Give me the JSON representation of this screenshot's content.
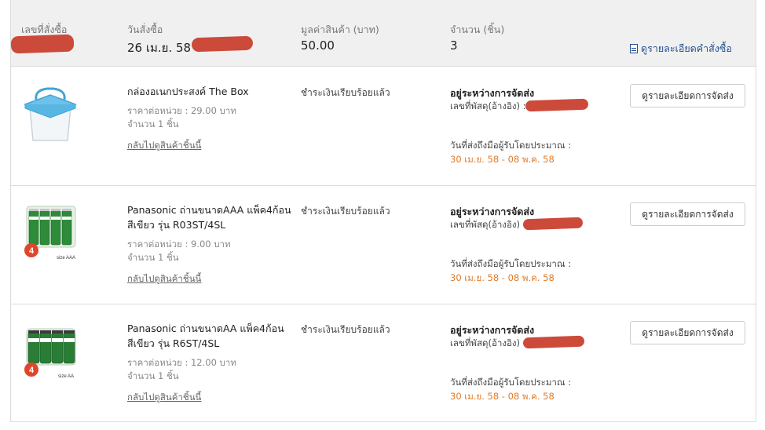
{
  "header": {
    "order_no_label": "เลขที่สั่งซื้อ",
    "order_date_label": "วันสั่งซื้อ",
    "order_date": "26 เม.ย. 58",
    "total_label": "มูลค่าสินค้า (บาท)",
    "total": "50.00",
    "qty_label": "จำนวน (ชิ้น)",
    "qty": "3",
    "detail_link": "ดูรายละเอียดคำสั่งซื้อ"
  },
  "items": [
    {
      "name": "กล่องอเนกประสงค์ The Box",
      "unit_price": "ราคาต่อหน่วย : 29.00 บาท",
      "quantity": "จำนวน 1 ชิ้น",
      "back_link": "กลับไปดูสินค้าชิ้นนี้",
      "payment": "ชำระเงินเรียบร้อยแล้ว",
      "status": "อยู่ระหว่างการจัดส่ง",
      "tracking_label": "เลขที่พัสดุ(อ้างอิง) :",
      "est_label": "วันที่ส่งถึงมือผู้รับโดยประมาณ :",
      "est_date": "30 เม.ย. 58 - 08 พ.ค. 58",
      "button": "ดูรายละเอียดการจัดส่ง"
    },
    {
      "name": "Panasonic ถ่านขนาดAAA แพ็ค4ก้อน สีเขียว รุ่น R03ST/4SL",
      "unit_price": "ราคาต่อหน่วย : 9.00 บาท",
      "quantity": "จำนวน 1 ชิ้น",
      "back_link": "กลับไปดูสินค้าชิ้นนี้",
      "payment": "ชำระเงินเรียบร้อยแล้ว",
      "status": "อยู่ระหว่างการจัดส่ง",
      "tracking_label": "เลขที่พัสดุ(อ้างอิง) :",
      "est_label": "วันที่ส่งถึงมือผู้รับโดยประมาณ :",
      "est_date": "30 เม.ย. 58 - 08 พ.ค. 58",
      "button": "ดูรายละเอียดการจัดส่ง"
    },
    {
      "name": "Panasonic ถ่านขนาดAA แพ็ค4ก้อน สีเขียว รุ่น R6ST/4SL",
      "unit_price": "ราคาต่อหน่วย : 12.00 บาท",
      "quantity": "จำนวน 1 ชิ้น",
      "back_link": "กลับไปดูสินค้าชิ้นนี้",
      "payment": "ชำระเงินเรียบร้อยแล้ว",
      "status": "อยู่ระหว่างการจัดส่ง",
      "tracking_label": "เลขที่พัสดุ(อ้างอิง) :",
      "est_label": "วันที่ส่งถึงมือผู้รับโดยประมาณ :",
      "est_date": "30 เม.ย. 58 - 08 พ.ค. 58",
      "button": "ดูรายละเอียดการจัดส่ง"
    }
  ],
  "battery_badge": "4",
  "battery_size_aaa": "size AAA",
  "battery_size_aa": "size AA",
  "colors": {
    "accent_orange": "#e07b2a",
    "link_blue": "#1f4e91",
    "redaction": "#cc4a3a"
  }
}
